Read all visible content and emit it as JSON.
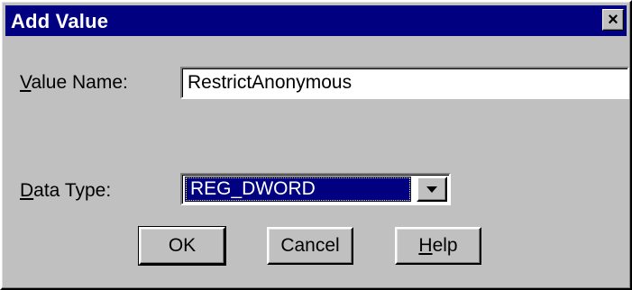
{
  "window": {
    "title": "Add Value",
    "close_glyph": "×"
  },
  "form": {
    "value_name": {
      "label_accel": "V",
      "label_rest": "alue Name:",
      "value": "RestrictAnonymous"
    },
    "data_type": {
      "label_accel": "D",
      "label_rest": "ata Type:",
      "selected": "REG_DWORD"
    }
  },
  "buttons": {
    "ok": "OK",
    "cancel": "Cancel",
    "help_accel": "H",
    "help_rest": "elp"
  }
}
